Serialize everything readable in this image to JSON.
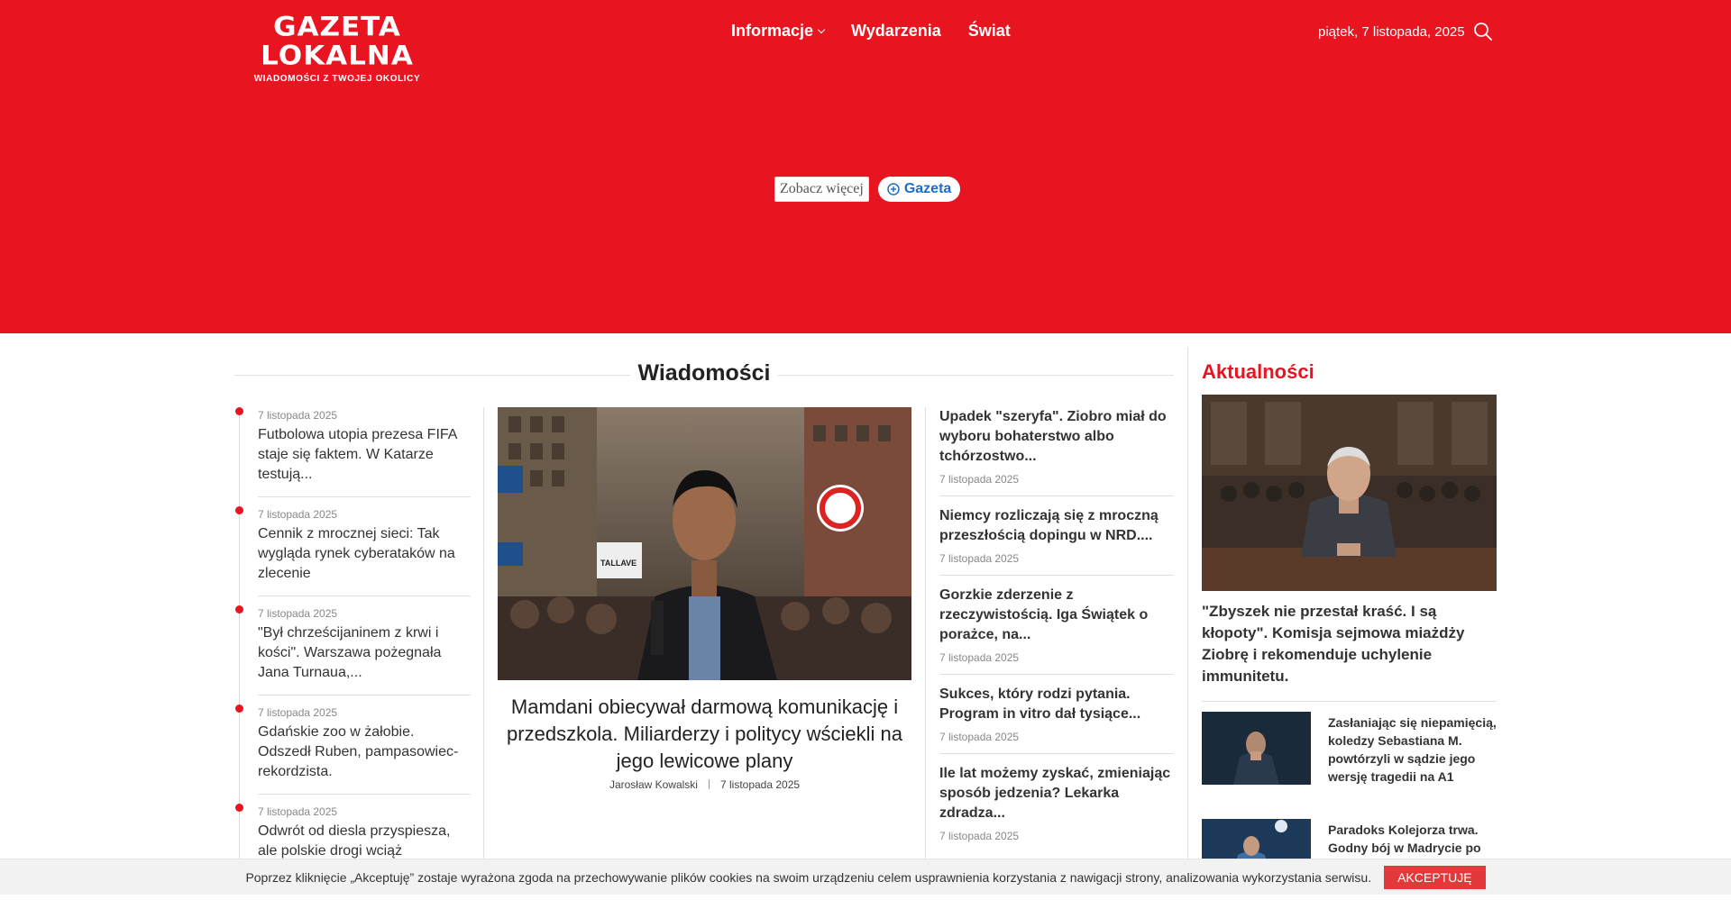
{
  "header": {
    "logo_title": "GAZETA LOKALNA",
    "logo_sub": "WIADOMOŚCI Z TWOJEJ OKOLICY",
    "nav": [
      {
        "label": "Informacje"
      },
      {
        "label": "Wydarzenia"
      },
      {
        "label": "Świat"
      }
    ],
    "date": "piątek, 7 listopada, 2025",
    "brand_color": "#e8141f"
  },
  "ad": {
    "zobacz": "Zobacz więcej",
    "gazeta": "Gazeta"
  },
  "section": {
    "title": "Wiadomości"
  },
  "timeline": [
    {
      "date": "7 listopada 2025",
      "title": "Futbolowa utopia prezesa FIFA staje się faktem. W Katarze testują..."
    },
    {
      "date": "7 listopada 2025",
      "title": "Cennik z mrocznej sieci: Tak wygląda rynek cyberataków na zlecenie"
    },
    {
      "date": "7 listopada 2025",
      "title": "\"Był chrześcijaninem z krwi i kości\". Warszawa pożegnała Jana Turnaua,..."
    },
    {
      "date": "7 listopada 2025",
      "title": "Gdańskie zoo w żałobie. Odszedł Ruben, pampasowiec-rekordzista."
    },
    {
      "date": "7 listopada 2025",
      "title": "Odwrót od diesla przyspiesza, ale polskie drogi wciąż"
    }
  ],
  "featured": {
    "title": "Mamdani obiecywał darmową komunikację i przedszkola. Miliarderzy i politycy wściekli na jego lewicowe plany",
    "author": "Jarosław Kowalski",
    "date": "7 listopada 2025",
    "sign_text": "TALLAVE"
  },
  "right_list": [
    {
      "title": "Upadek \"szeryfa\". Ziobro miał do wyboru bohaterstwo albo tchórzostwo...",
      "date": "7 listopada 2025"
    },
    {
      "title": "Niemcy rozliczają się z mroczną przeszłością dopingu w NRD....",
      "date": "7 listopada 2025"
    },
    {
      "title": "Gorzkie zderzenie z rzeczywistością. Iga Świątek o porażce, na...",
      "date": "7 listopada 2025"
    },
    {
      "title": "Sukces, który rodzi pytania. Program in vitro dał tysiące...",
      "date": "7 listopada 2025"
    },
    {
      "title": "Ile lat możemy zyskać, zmieniając sposób jedzenia? Lekarka zdradza...",
      "date": "7 listopada 2025"
    }
  ],
  "aside": {
    "title": "Aktualności",
    "main_title": "\"Zbyszek nie przestał kraść. I są kłopoty\". Komisja sejmowa miażdży Ziobrę i rekomenduje uchylenie immunitetu.",
    "small": [
      {
        "title": "Zasłaniając się niepamięcią, koledzy Sebastiana M. powtórzyli w sądzie jego wersję tragedii na A1"
      },
      {
        "title": "Paradoks Kolejorza trwa. Godny bój w Madrycie po"
      }
    ]
  },
  "cookie": {
    "text": "Poprzez kliknięcie „Akceptuję” zostaje wyrażona zgoda na przechowywanie plików cookies na swoim urządzeniu celem usprawnienia korzystania z nawigacji strony, analizowania wykorzystania serwisu.",
    "button": "AKCEPTUJĘ"
  }
}
